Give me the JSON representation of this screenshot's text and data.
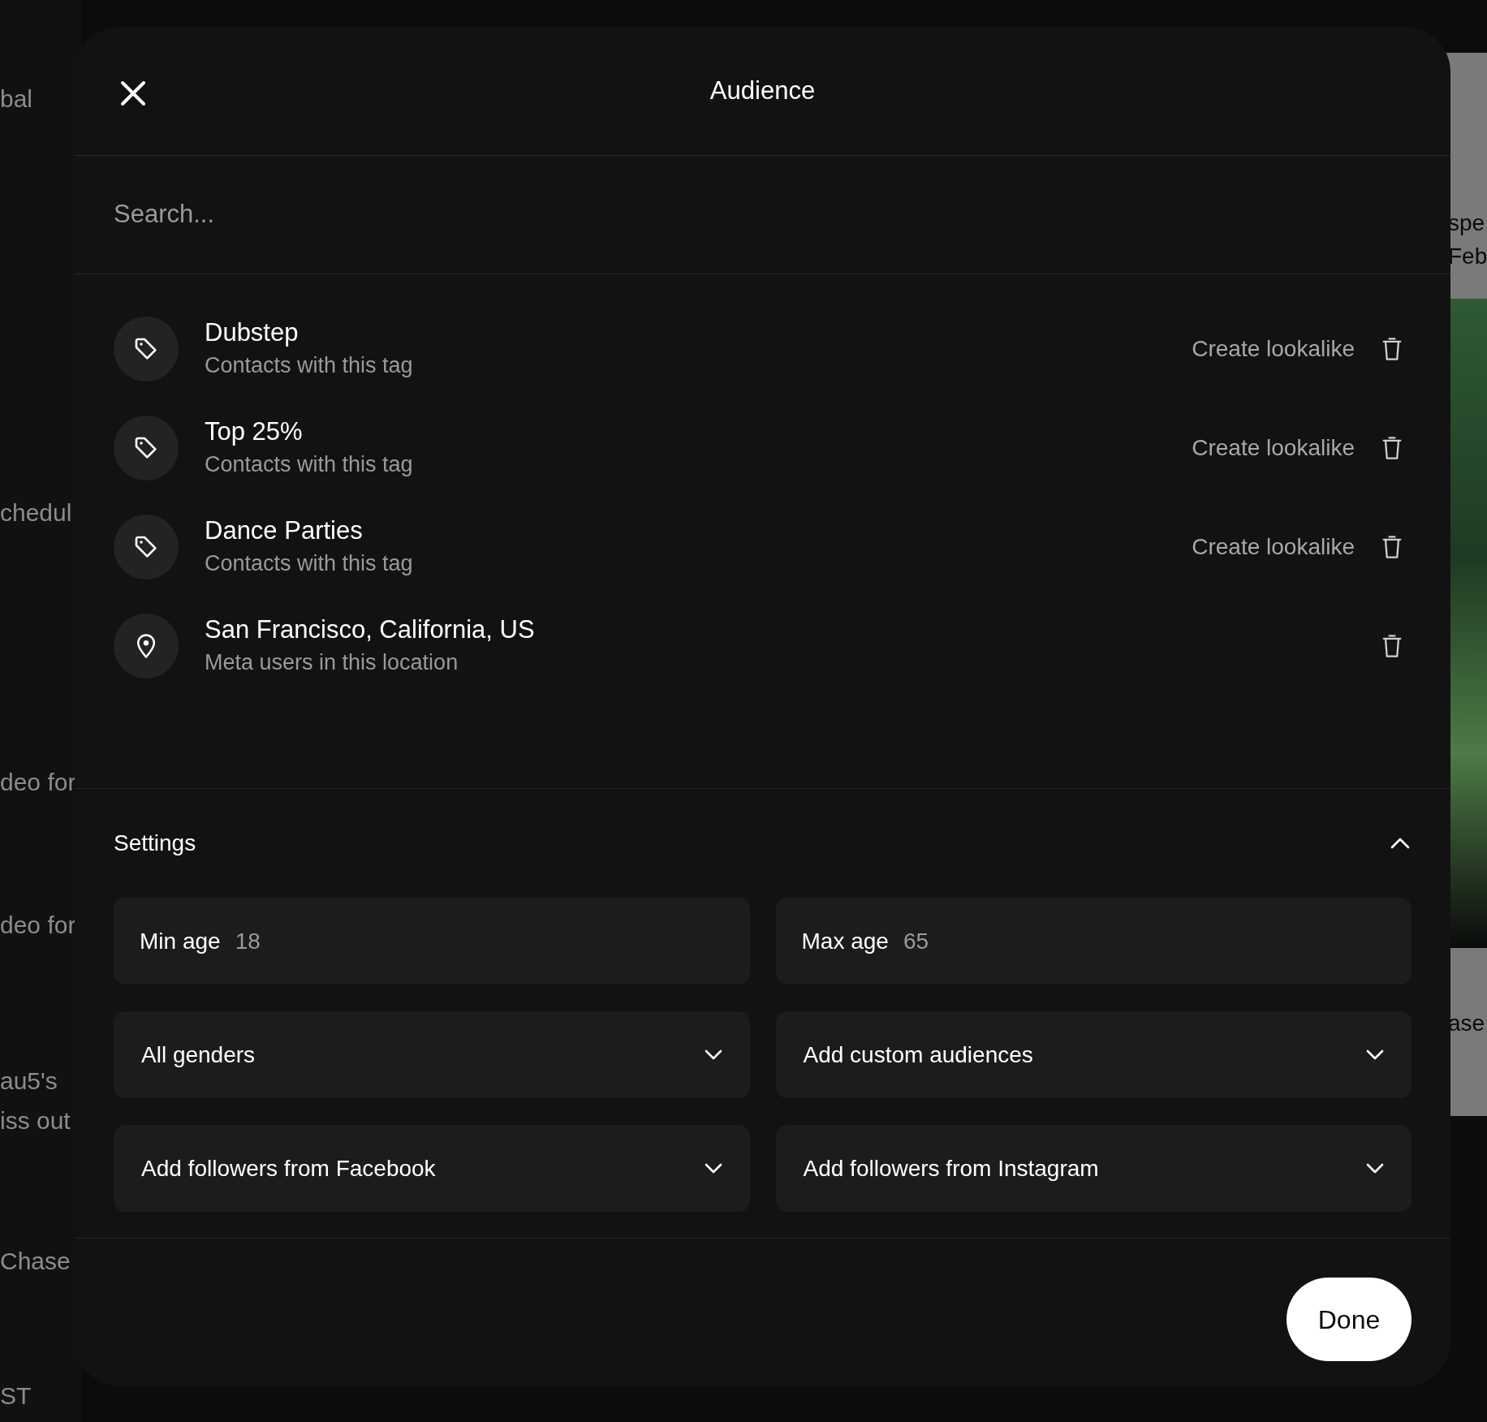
{
  "background": {
    "left_texts": [
      "bal",
      "chedul",
      "deo for",
      "deo for",
      "au5's",
      "iss out",
      "Chase",
      "ST"
    ],
    "right_texts": [
      "spe",
      "Feb",
      "ase"
    ]
  },
  "dialog": {
    "title": "Audience",
    "search": {
      "placeholder": "Search..."
    },
    "audiences": [
      {
        "kind": "tag",
        "name": "Dubstep",
        "description": "Contacts with this tag",
        "action": "Create lookalike"
      },
      {
        "kind": "tag",
        "name": "Top 25%",
        "description": "Contacts with this tag",
        "action": "Create lookalike"
      },
      {
        "kind": "tag",
        "name": "Dance Parties",
        "description": "Contacts with this tag",
        "action": "Create lookalike"
      },
      {
        "kind": "location",
        "name": "San Francisco, California, US",
        "description": "Meta users in this location"
      }
    ],
    "settings": {
      "title": "Settings",
      "expanded": true,
      "fields": [
        {
          "kind": "number",
          "label": "Min age",
          "value": "18"
        },
        {
          "kind": "number",
          "label": "Max age",
          "value": "65"
        },
        {
          "kind": "select",
          "label": "All genders"
        },
        {
          "kind": "select",
          "label": "Add custom audiences"
        },
        {
          "kind": "select",
          "label": "Add followers from Facebook"
        },
        {
          "kind": "select",
          "label": "Add followers from Instagram"
        }
      ]
    },
    "done_button": "Done"
  }
}
